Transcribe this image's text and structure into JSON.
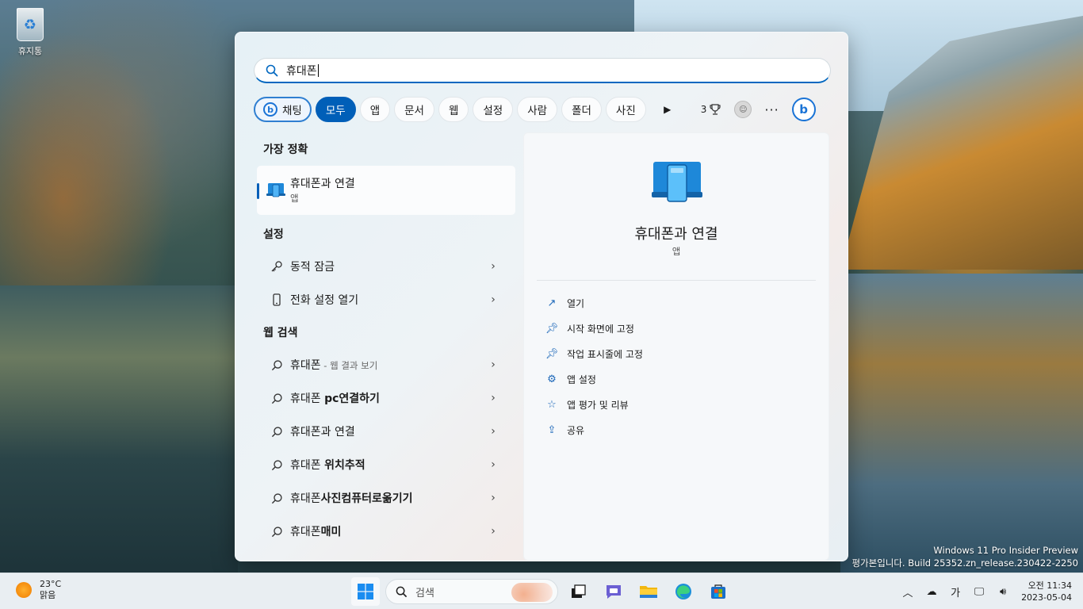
{
  "desktop": {
    "recycle_bin_label": "휴지통",
    "watermark_line1": "Windows 11 Pro Insider Preview",
    "watermark_line2": "평가본입니다. Build 25352.zn_release.230422-2250"
  },
  "search": {
    "query": "휴대폰"
  },
  "filters": {
    "chat": "채팅",
    "items": [
      "모두",
      "앱",
      "문서",
      "웹",
      "설정",
      "사람",
      "폴더",
      "사진"
    ],
    "active": "모두",
    "points": "3"
  },
  "results": {
    "best_match_title": "가장 정확",
    "best_match": {
      "name": "휴대폰과 연결",
      "type": "앱"
    },
    "settings_title": "설정",
    "settings": [
      {
        "label": "동적 잠금",
        "icon": "key-icon"
      },
      {
        "label": "전화 설정 열기",
        "icon": "phone-icon"
      }
    ],
    "web_title": "웹 검색",
    "web": [
      {
        "main": "휴대폰",
        "sub": " - 웹 결과 보기",
        "bold_part": ""
      },
      {
        "main": "휴대폰 ",
        "sub": "",
        "bold_part": "pc연결하기"
      },
      {
        "main": "휴대폰",
        "sub": "",
        "bold_part": "과 연결"
      },
      {
        "main": "휴대폰 ",
        "sub": "",
        "bold_part": "위치추적"
      },
      {
        "main": "휴대폰",
        "sub": "",
        "bold_part": "사진컴퓨터로옮기기"
      },
      {
        "main": "휴대폰",
        "sub": "",
        "bold_part": "매미"
      }
    ]
  },
  "preview": {
    "title": "휴대폰과 연결",
    "subtitle": "앱",
    "actions": [
      {
        "label": "열기",
        "icon": "open-external-icon"
      },
      {
        "label": "시작 화면에 고정",
        "icon": "pin-icon"
      },
      {
        "label": "작업 표시줄에 고정",
        "icon": "pin-icon"
      },
      {
        "label": "앱 설정",
        "icon": "gear-icon"
      },
      {
        "label": "앱 평가 및 리뷰",
        "icon": "star-icon"
      },
      {
        "label": "공유",
        "icon": "share-icon"
      }
    ]
  },
  "taskbar": {
    "temperature": "23°C",
    "weather": "맑음",
    "search_placeholder": "검색",
    "ime": "가",
    "time": "오전 11:34",
    "date": "2023-05-04"
  },
  "colors": {
    "accent": "#005fb8",
    "bing": "#1a73d6"
  }
}
